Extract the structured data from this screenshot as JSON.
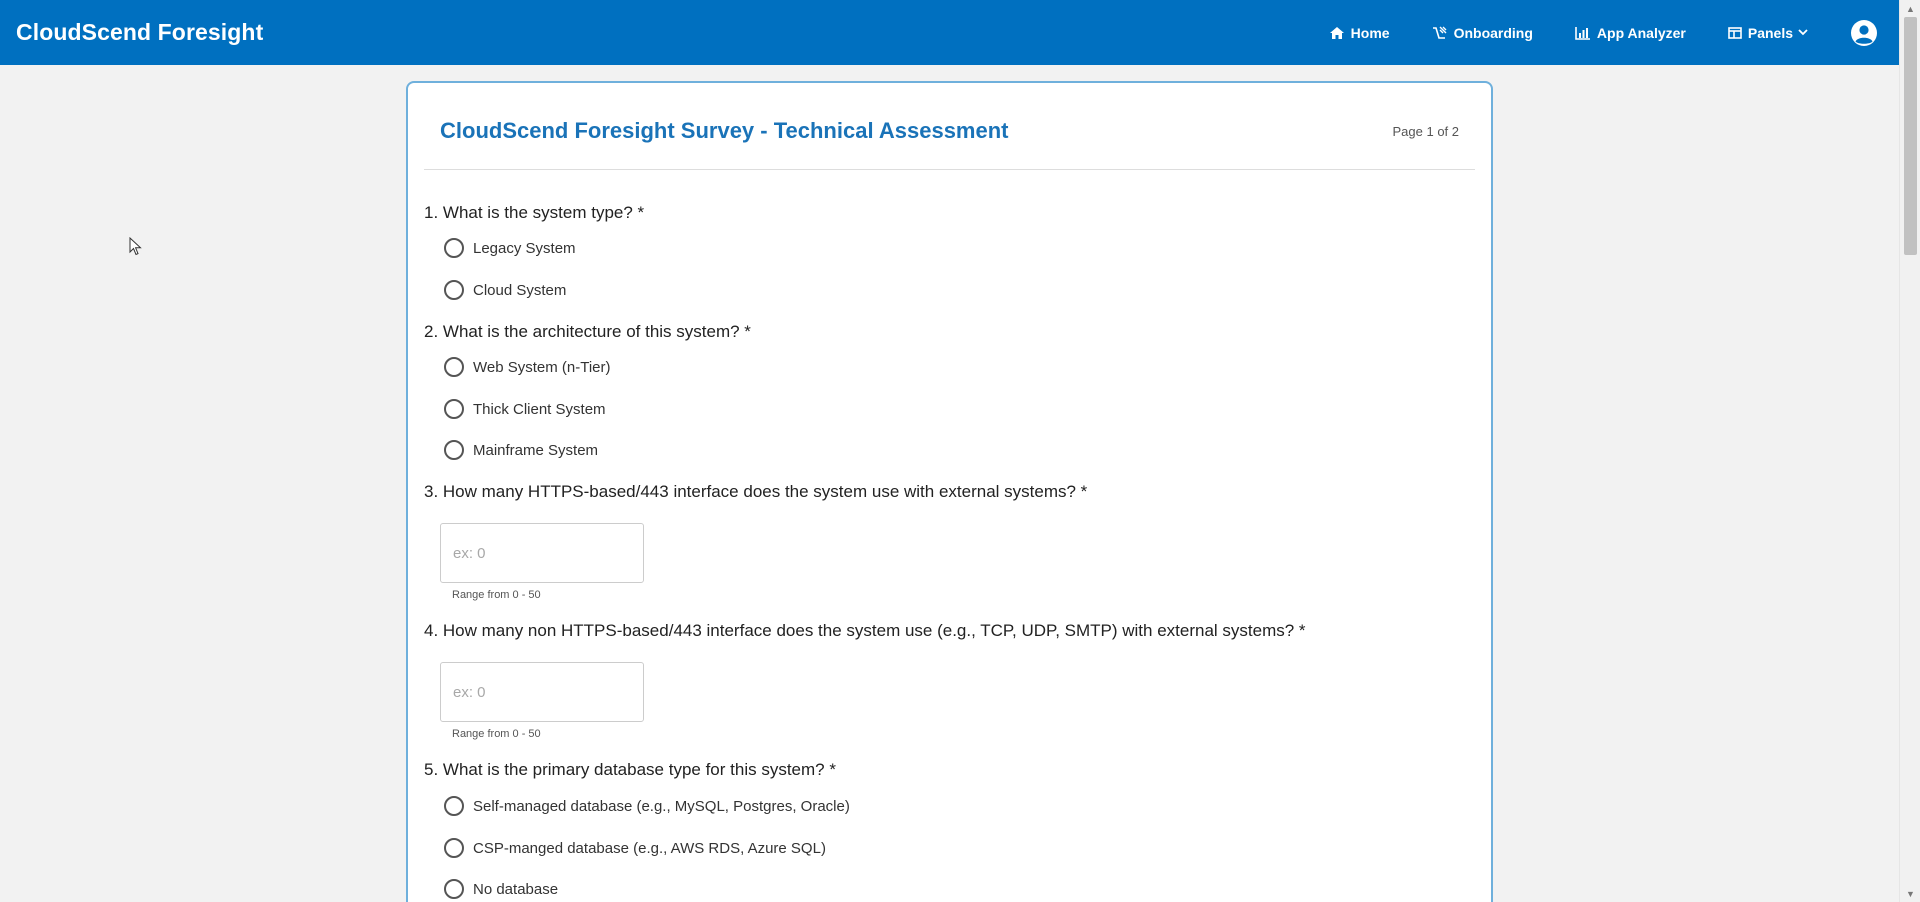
{
  "header": {
    "brand": "CloudScend Foresight",
    "nav": [
      {
        "label": "Home",
        "icon": "home-icon"
      },
      {
        "label": "Onboarding",
        "icon": "onboarding-icon"
      },
      {
        "label": "App Analyzer",
        "icon": "chart-icon"
      },
      {
        "label": "Panels",
        "icon": "panels-icon"
      }
    ],
    "account_icon": "user-circle-icon"
  },
  "survey": {
    "title": "CloudScend Foresight Survey - Technical Assessment",
    "page_indicator": "Page 1 of 2",
    "questions": [
      {
        "text": "1. What is the system type? *",
        "options": [
          "Legacy System",
          "Cloud System"
        ]
      },
      {
        "text": "2. What is the architecture of this system? *",
        "options": [
          "Web System (n-Tier)",
          "Thick Client System",
          "Mainframe System"
        ]
      },
      {
        "text": "3. How many HTTPS-based/443 interface does the system use with external systems? *",
        "placeholder": "ex: 0",
        "hint": "Range from 0 - 50"
      },
      {
        "text": "4. How many non HTTPS-based/443 interface does the system use (e.g., TCP, UDP, SMTP) with external systems? *",
        "placeholder": "ex: 0",
        "hint": "Range from 0 - 50"
      },
      {
        "text": "5. What is the primary database type for this system? *",
        "options": [
          "Self-managed database (e.g., MySQL, Postgres, Oracle)",
          "CSP-manged database (e.g., AWS RDS, Azure SQL)",
          "No database"
        ]
      }
    ]
  },
  "colors": {
    "header_bg": "#0070c0",
    "title": "#1a73b8",
    "card_border": "#6fb0dc",
    "page_bg": "#f2f2f2"
  }
}
